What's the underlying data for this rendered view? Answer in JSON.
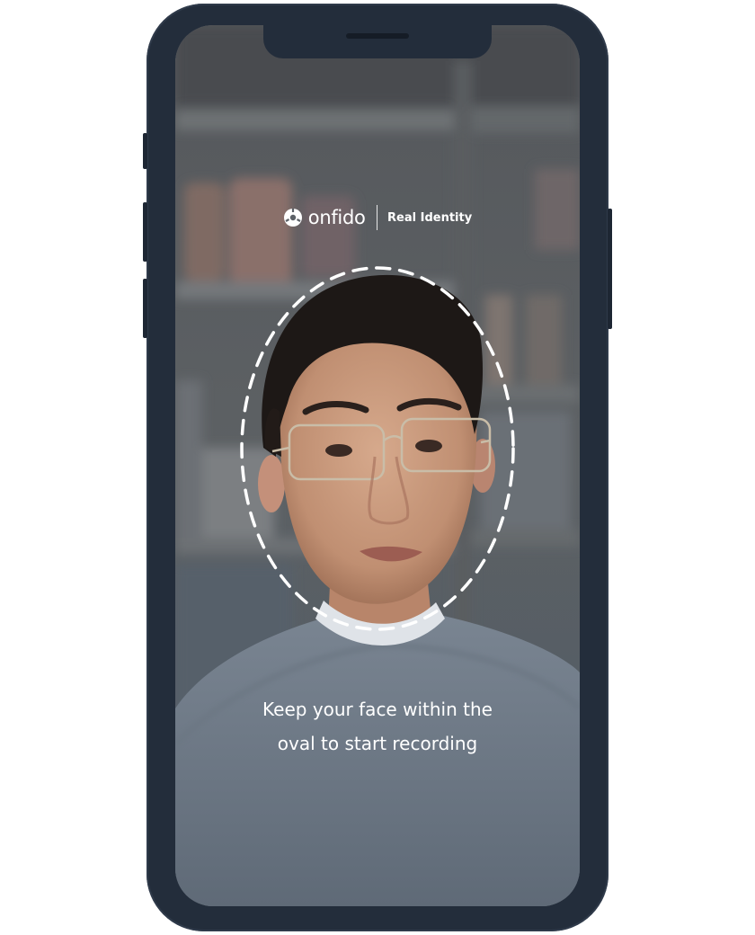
{
  "brand": {
    "name": "onfido",
    "tagline": "Real Identity",
    "logo_icon": "onfido-logo-icon"
  },
  "capture": {
    "guide_shape": "dashed-oval",
    "instruction_line1": "Keep your face within the",
    "instruction_line2": "oval to start recording"
  },
  "colors": {
    "phone_frame": "#232d3b",
    "overlay_text": "#ffffff",
    "oval_stroke": "#ffffff"
  }
}
